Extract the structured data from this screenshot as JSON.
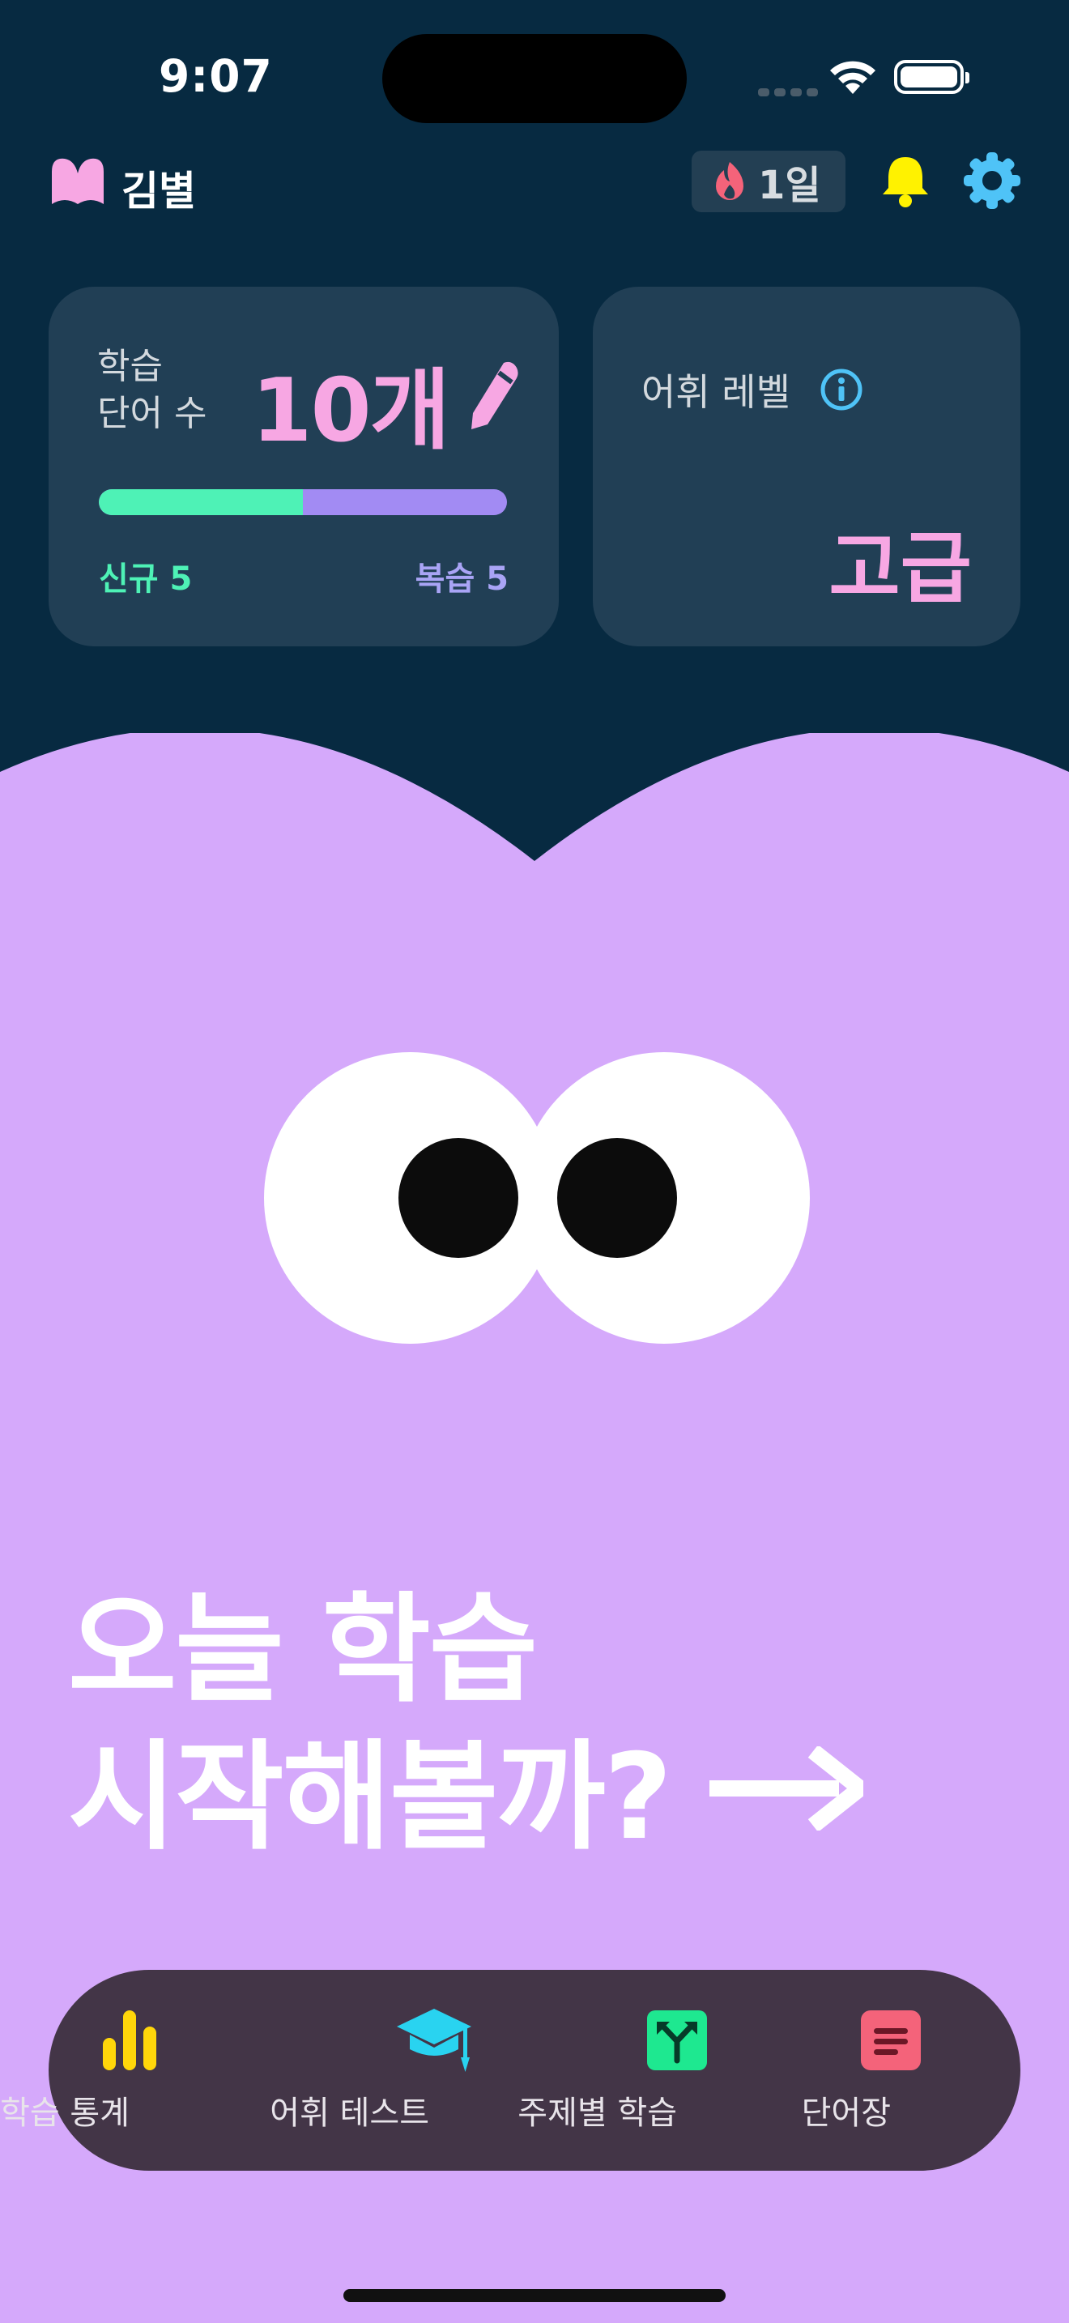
{
  "status_bar": {
    "time": "9:07"
  },
  "header": {
    "username": "김별",
    "streak": "1일",
    "colors": {
      "logo": "#F7A7E3",
      "bell": "#FFF200",
      "gear": "#4FC3F7",
      "flame": "#F4637A"
    }
  },
  "words_card": {
    "label_line1": "학습",
    "label_line2": "단어 수",
    "count": "10개",
    "new_label": "신규 5",
    "review_label": "복습 5",
    "progress_new_fraction": 0.5,
    "colors": {
      "new": "#4EF2B6",
      "review": "#A28BF3",
      "count": "#F7A7E3"
    }
  },
  "level_card": {
    "label": "어휘 레벨",
    "value": "고급"
  },
  "cta": {
    "line1": "오늘 학습",
    "line2": "시작해볼까?"
  },
  "nav": {
    "items": [
      {
        "label": "학습 통계",
        "icon": "bar-chart-icon",
        "color": "#FFD60A"
      },
      {
        "label": "어휘 테스트",
        "icon": "graduation-cap-icon",
        "color": "#29D3F0"
      },
      {
        "label": "주제별 학습",
        "icon": "split-arrows-icon",
        "color": "#1EE890"
      },
      {
        "label": "단어장",
        "icon": "notebook-icon",
        "color": "#F4637A"
      }
    ]
  },
  "theme": {
    "top_bg": "#072A41",
    "body_bg": "#D5A9FB",
    "card_bg": "#213F55",
    "navbar_bg": "#433547"
  }
}
